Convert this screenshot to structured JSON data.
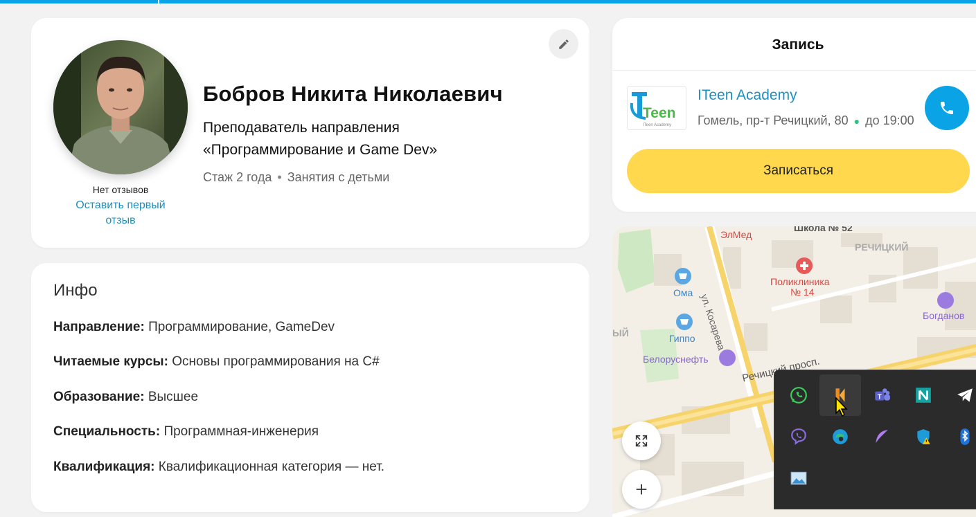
{
  "profile": {
    "name": "Бобров Никита Николаевич",
    "position_line1": "Преподаватель направления",
    "position_line2": "«Программирование и Game Dev»",
    "experience": "Стаж 2 года",
    "separator": "•",
    "children": "Занятия с детьми",
    "no_reviews": "Нет отзывов",
    "leave_review": "Оставить первый отзыв"
  },
  "info": {
    "title": "Инфо",
    "rows": [
      {
        "label": "Направление:",
        "value": "Программирование, GameDev"
      },
      {
        "label": "Читаемые курсы:",
        "value": "Основы программирования на C#"
      },
      {
        "label": "Образование:",
        "value": "Высшее"
      },
      {
        "label": "Специальность:",
        "value": "Программная-инженерия"
      },
      {
        "label": "Квалификация:",
        "value": "Квалификационная категория — нет."
      }
    ]
  },
  "booking": {
    "title": "Запись",
    "academy": "ITeen Academy",
    "address": "Гомель, пр-т Речицкий, 80",
    "hours": "до 19:00",
    "signup": "Записаться",
    "logo_text": "Teen",
    "logo_sub": "ITeen Academy"
  },
  "map": {
    "labels": {
      "school": "Школа № 52",
      "elmed": "ЭлМед",
      "rechitsky": "РЕЧИЦКИЙ",
      "poly1": "Поликлиника",
      "poly2": "№ 14",
      "oma": "Ома",
      "kosareva": "ул. Косарева",
      "bogdanov": "Богданов",
      "gippo": "Гиппо",
      "yy": "ЫЙ",
      "belor": "Белоруснефть",
      "prosp": "Речицкий просп."
    }
  },
  "tray": {
    "icons": [
      "whatsapp-icon",
      "app-orange-icon",
      "teams-icon",
      "notion-like-icon",
      "telegram-icon",
      "viber-icon",
      "edge-icon",
      "feather-icon",
      "defender-warning-icon",
      "bluetooth-icon",
      "image-viewer-icon"
    ]
  },
  "colors": {
    "accent": "#0aa3e6",
    "link": "#1f8fbf",
    "button": "#ffd84d"
  }
}
